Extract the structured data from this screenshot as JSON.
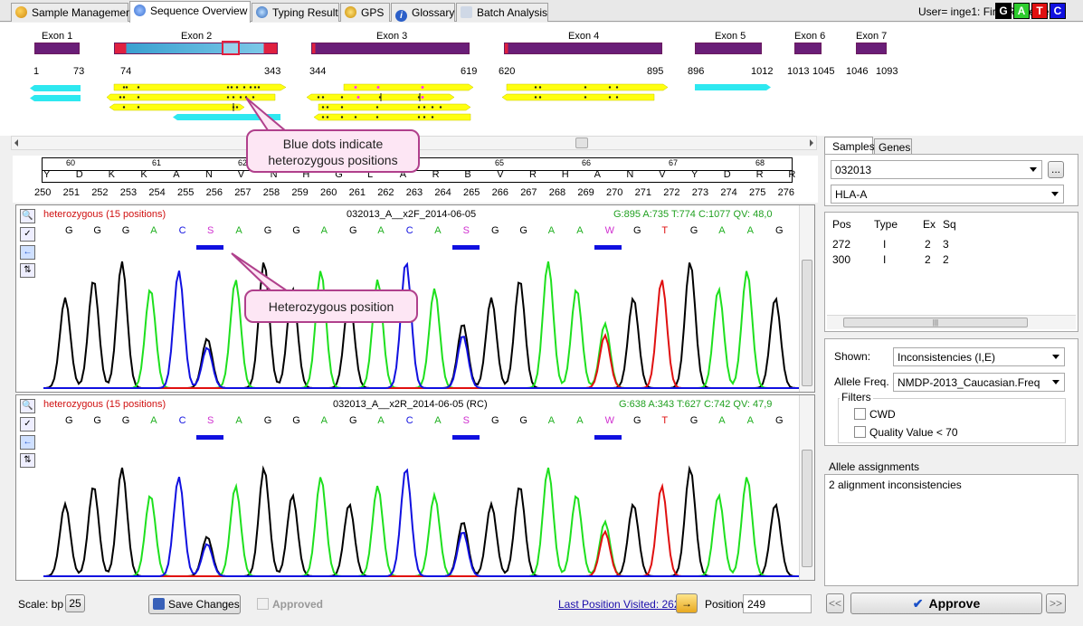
{
  "tabs": [
    {
      "label": "Sample Management",
      "icon": "sample-management-icon"
    },
    {
      "label": "Sequence Overview",
      "icon": "sequence-overview-icon"
    },
    {
      "label": "Typing Result",
      "icon": "typing-result-icon"
    },
    {
      "label": "GPS",
      "icon": "gps-icon"
    },
    {
      "label": "Glossary",
      "icon": "glossary-info-icon"
    },
    {
      "label": "Batch Analysis",
      "icon": "batch-analysis-icon"
    }
  ],
  "user": "User= inge1: First Reviewer",
  "bases_legend": [
    {
      "letter": "G",
      "color": "#000000"
    },
    {
      "letter": "A",
      "color": "#2ecc2e"
    },
    {
      "letter": "T",
      "color": "#e01010"
    },
    {
      "letter": "C",
      "color": "#1010e0"
    }
  ],
  "exons": [
    {
      "label": "Exon 1",
      "start": "1",
      "end": "73"
    },
    {
      "label": "Exon 2",
      "start": "74",
      "end": "343"
    },
    {
      "label": "Exon 3",
      "start": "344",
      "end": "619"
    },
    {
      "label": "Exon 4",
      "start": "620",
      "end": "895"
    },
    {
      "label": "Exon 5",
      "start": "896",
      "end": "1012"
    },
    {
      "label": "Exon 6",
      "start": "1013",
      "end": "1045"
    },
    {
      "label": "Exon 7",
      "start": "1046",
      "end": "1093"
    }
  ],
  "callouts": {
    "blue_dots": "Blue dots indicate heterozygous positions",
    "het_position": "Heterozygous position"
  },
  "ruler": {
    "codon_numbers": [
      "60",
      "61",
      "62",
      "63",
      "64",
      "65",
      "66",
      "67",
      "68"
    ],
    "amino_acids": [
      "Y",
      "D",
      "K",
      "K",
      "A",
      "N",
      "V",
      "N",
      "H",
      "G",
      "L",
      "A",
      "R",
      "B",
      "V",
      "R",
      "H",
      "A",
      "N",
      "V",
      "Y",
      "D",
      "R",
      "R"
    ],
    "positions": [
      "250",
      "251",
      "252",
      "253",
      "254",
      "255",
      "256",
      "257",
      "258",
      "259",
      "260",
      "261",
      "262",
      "263",
      "264",
      "265",
      "266",
      "267",
      "268",
      "269",
      "270",
      "271",
      "272",
      "273",
      "274",
      "275",
      "276"
    ]
  },
  "traces": [
    {
      "status": "heterozygous (15 positions)",
      "name": "032013_A__x2F_2014-06-05",
      "stats": "G:895 A:735 T:774 C:1077 QV: 48,0",
      "bases": [
        "G",
        "G",
        "G",
        "A",
        "C",
        "S",
        "A",
        "G",
        "G",
        "A",
        "G",
        "A",
        "C",
        "A",
        "S",
        "G",
        "G",
        "A",
        "A",
        "W",
        "G",
        "T",
        "G",
        "A",
        "A",
        "G"
      ]
    },
    {
      "status": "heterozygous (15 positions)",
      "name": "032013_A__x2R_2014-06-05 (RC)",
      "stats": "G:638 A:343 T:627 C:742 QV: 47,9",
      "bases": [
        "G",
        "G",
        "G",
        "A",
        "C",
        "S",
        "A",
        "G",
        "G",
        "A",
        "G",
        "A",
        "C",
        "A",
        "S",
        "G",
        "G",
        "A",
        "A",
        "W",
        "G",
        "T",
        "G",
        "A",
        "A",
        "G"
      ]
    }
  ],
  "right": {
    "tabs": [
      "Samples",
      "Genes"
    ],
    "sample_value": "032013",
    "browse_label": "...",
    "gene_value": "HLA-A",
    "table": {
      "headers": [
        "Pos",
        "Type",
        "Ex",
        "Sq"
      ],
      "rows": [
        [
          "272",
          "I",
          "2",
          "3"
        ],
        [
          "300",
          "I",
          "2",
          "2"
        ]
      ]
    },
    "shown_label": "Shown:",
    "shown_value": "Inconsistencies (I,E)",
    "allele_freq_label": "Allele Freq.",
    "allele_freq_value": "NMDP-2013_Caucasian.Freq",
    "filters_label": "Filters",
    "filter_cwd": "CWD",
    "filter_qv": "Quality Value < 70",
    "allele_assign_label": "Allele assignments",
    "allele_assign_text": "2 alignment inconsistencies",
    "prev_label": "<<",
    "approve_label": "Approve",
    "next_label": ">>"
  },
  "bottom": {
    "scale_label": "Scale: bp",
    "scale_value": "25",
    "save_label": "Save Changes",
    "approved_label": "Approved",
    "last_visited": "Last Position Visited: 262",
    "position_label": "Position",
    "position_value": "249"
  }
}
